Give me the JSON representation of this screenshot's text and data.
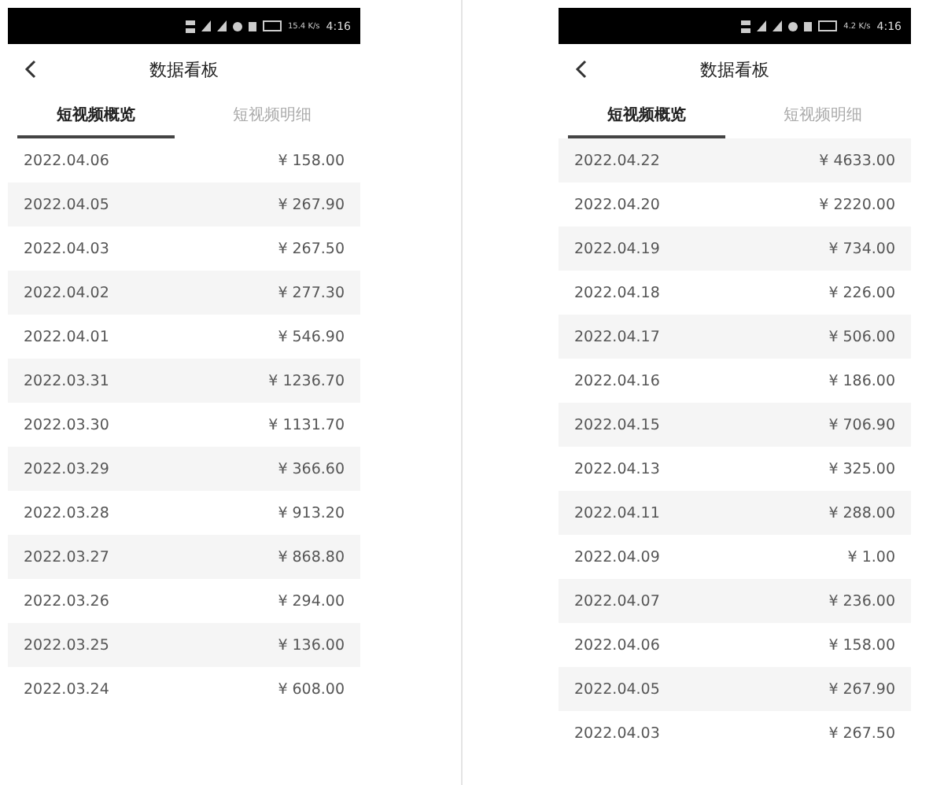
{
  "phones": [
    {
      "status_bar": {
        "net_speed": "15.4 K/s",
        "time": "4:16"
      },
      "title": "数据看板",
      "tabs": [
        {
          "label": "短视频概览",
          "selected": true
        },
        {
          "label": "短视频明细",
          "selected": false
        }
      ],
      "rows": [
        {
          "date": "2022.04.06",
          "amount": "¥ 158.00"
        },
        {
          "date": "2022.04.05",
          "amount": "¥ 267.90"
        },
        {
          "date": "2022.04.03",
          "amount": "¥ 267.50"
        },
        {
          "date": "2022.04.02",
          "amount": "¥ 277.30"
        },
        {
          "date": "2022.04.01",
          "amount": "¥ 546.90"
        },
        {
          "date": "2022.03.31",
          "amount": "¥ 1236.70"
        },
        {
          "date": "2022.03.30",
          "amount": "¥ 1131.70"
        },
        {
          "date": "2022.03.29",
          "amount": "¥ 366.60"
        },
        {
          "date": "2022.03.28",
          "amount": "¥ 913.20"
        },
        {
          "date": "2022.03.27",
          "amount": "¥ 868.80"
        },
        {
          "date": "2022.03.26",
          "amount": "¥ 294.00"
        },
        {
          "date": "2022.03.25",
          "amount": "¥ 136.00"
        },
        {
          "date": "2022.03.24",
          "amount": "¥ 608.00"
        }
      ]
    },
    {
      "status_bar": {
        "net_speed": "4.2 K/s",
        "time": "4:16"
      },
      "title": "数据看板",
      "tabs": [
        {
          "label": "短视频概览",
          "selected": true
        },
        {
          "label": "短视频明细",
          "selected": false
        }
      ],
      "rows": [
        {
          "date": "2022.04.22",
          "amount": "¥ 4633.00"
        },
        {
          "date": "2022.04.20",
          "amount": "¥ 2220.00"
        },
        {
          "date": "2022.04.19",
          "amount": "¥ 734.00"
        },
        {
          "date": "2022.04.18",
          "amount": "¥ 226.00"
        },
        {
          "date": "2022.04.17",
          "amount": "¥ 506.00"
        },
        {
          "date": "2022.04.16",
          "amount": "¥ 186.00"
        },
        {
          "date": "2022.04.15",
          "amount": "¥ 706.90"
        },
        {
          "date": "2022.04.13",
          "amount": "¥ 325.00"
        },
        {
          "date": "2022.04.11",
          "amount": "¥ 288.00"
        },
        {
          "date": "2022.04.09",
          "amount": "¥ 1.00"
        },
        {
          "date": "2022.04.07",
          "amount": "¥ 236.00"
        },
        {
          "date": "2022.04.06",
          "amount": "¥ 158.00"
        },
        {
          "date": "2022.04.05",
          "amount": "¥ 267.90"
        },
        {
          "date": "2022.04.03",
          "amount": "¥ 267.50"
        }
      ]
    }
  ]
}
